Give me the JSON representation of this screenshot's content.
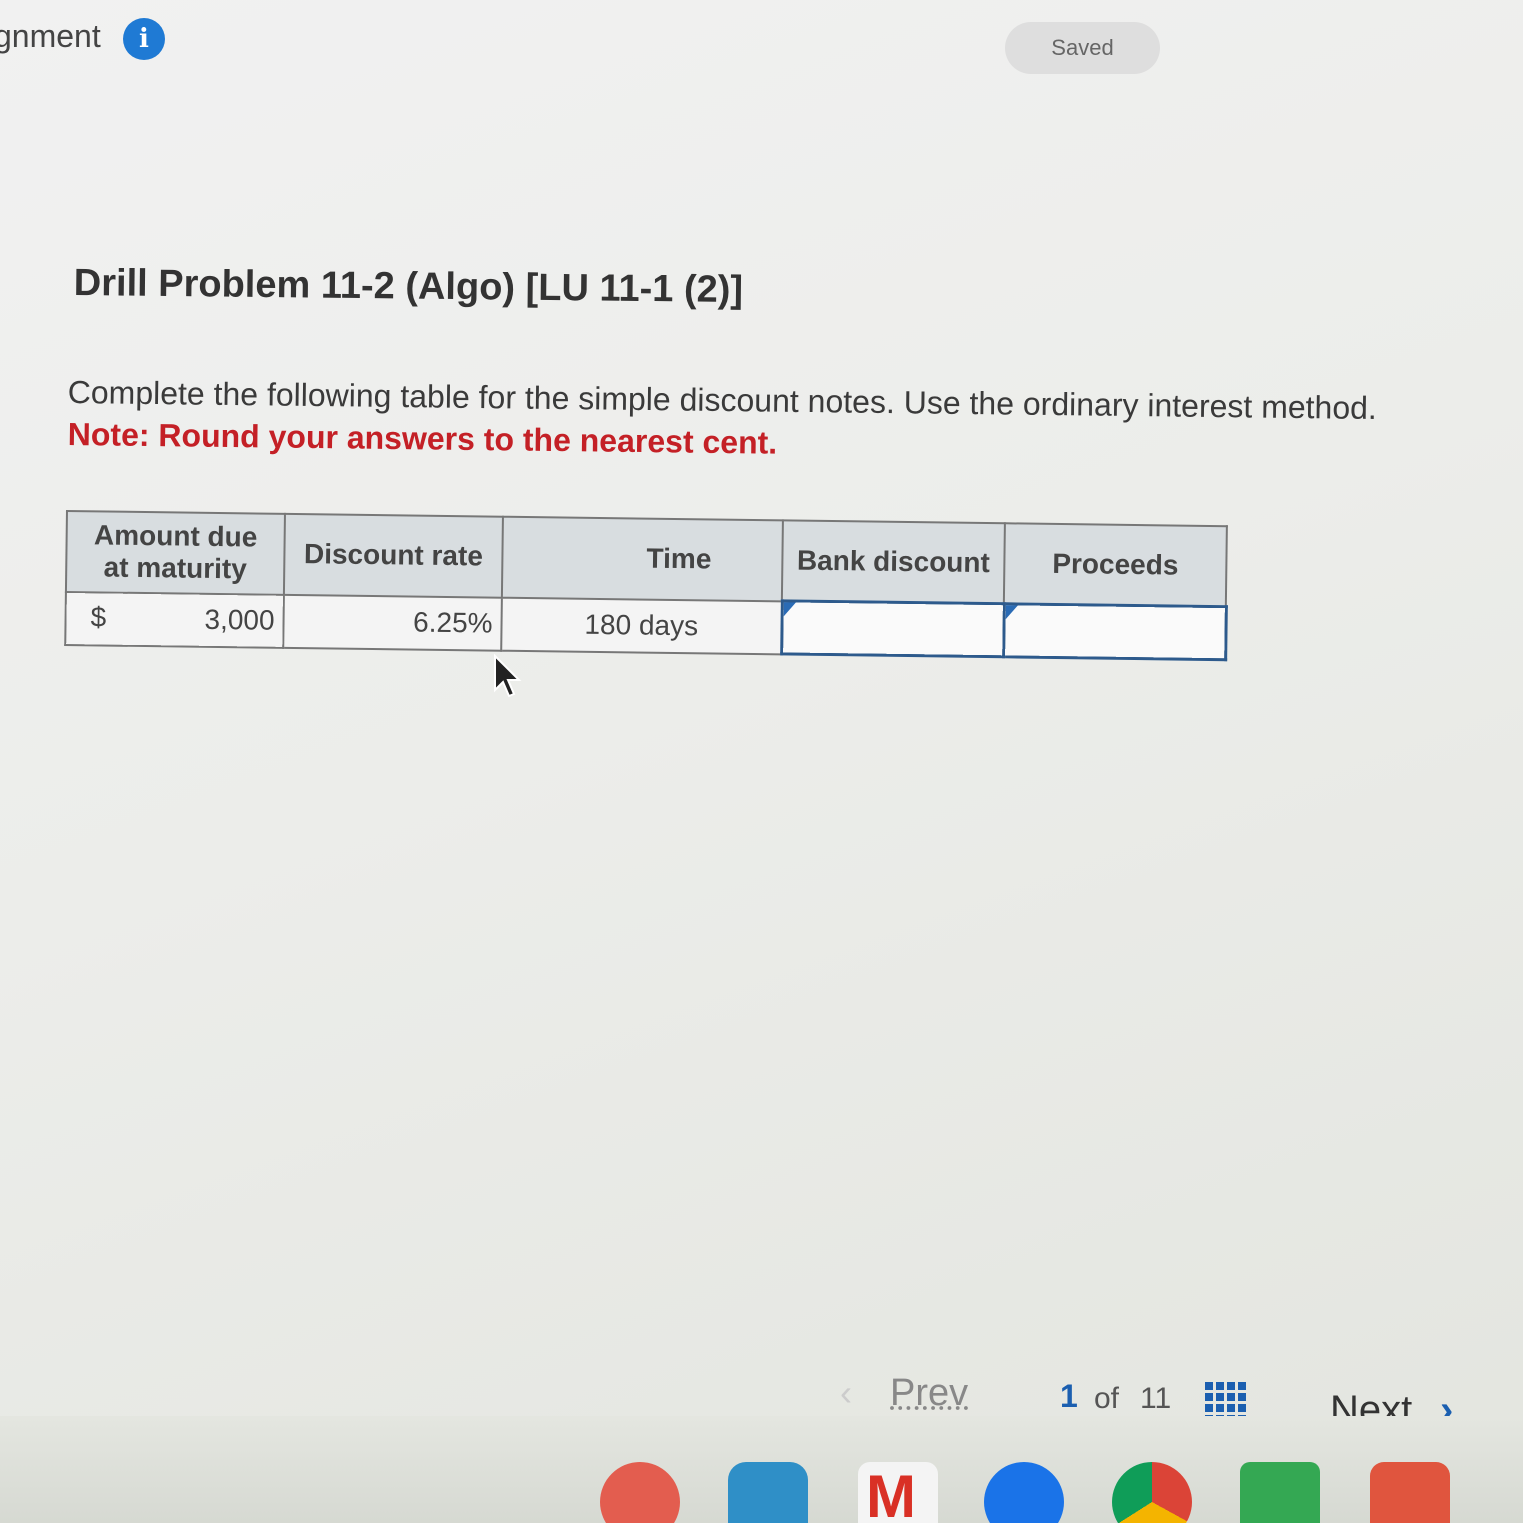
{
  "header": {
    "assignment_title": "gnment",
    "info_icon": "info-icon",
    "saved_label": "Saved"
  },
  "question": {
    "title": "Drill Problem 11-2 (Algo) [LU 11-1 (2)]",
    "instructions": "Complete the following table for the simple discount notes. Use the ordinary interest method.",
    "note": "Note: Round your answers to the nearest cent."
  },
  "table": {
    "headers": {
      "amount_line1": "Amount due",
      "amount_line2": "at maturity",
      "discount_rate": "Discount rate",
      "time": "Time",
      "bank_discount": "Bank discount",
      "proceeds": "Proceeds"
    },
    "row": {
      "currency": "$",
      "amount": "3,000",
      "discount_rate": "6.25%",
      "time": "180 days",
      "bank_discount": "",
      "proceeds": ""
    }
  },
  "pagination": {
    "prev_label": "Prev",
    "current": "1",
    "of": "of",
    "total": "11",
    "next_label": "Next"
  },
  "colors": {
    "note_red": "#c42026",
    "accent_blue": "#1b5fb0",
    "info_blue": "#1f7ad4",
    "answer_border": "#2d5a8c"
  }
}
